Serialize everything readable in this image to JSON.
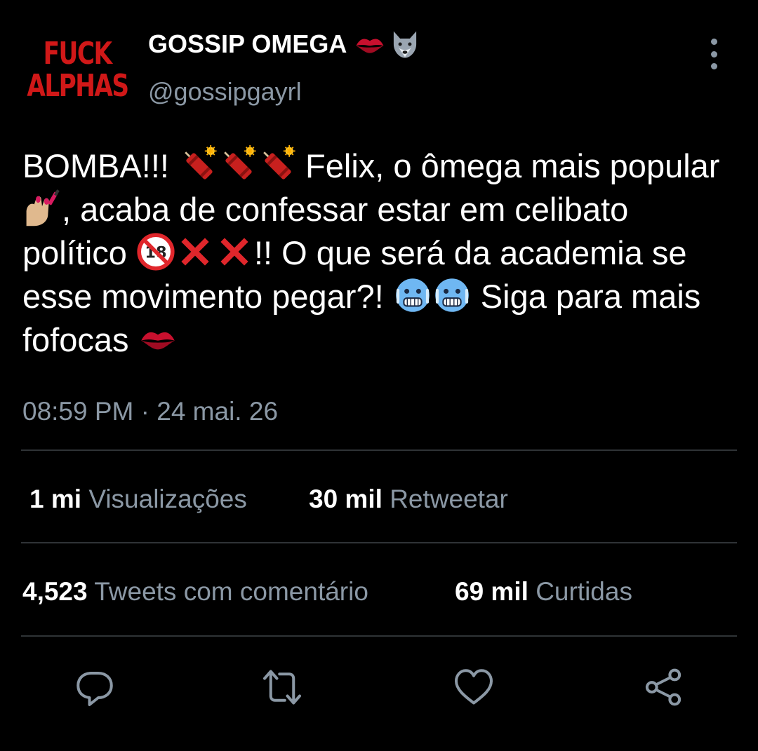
{
  "profile": {
    "avatar_line1": "FUCK",
    "avatar_line2": "ALPHAS",
    "display_name": "GOSSIP OMEGA",
    "display_name_emojis": [
      "kiss-mark-icon",
      "wolf-icon"
    ],
    "handle": "@gossipgayrl"
  },
  "tweet": {
    "segments": {
      "s1": "BOMBA!!! ",
      "s2": " Felix, o ômega mais popular ",
      "s3": ", acaba de confessar estar em celibato político ",
      "s4": "!! O que será da academia se esse movimento pegar?! ",
      "s5": " Siga para mais fofocas "
    },
    "emojis": [
      "firecracker-icon",
      "firecracker-icon",
      "firecracker-icon",
      "nail-polish-icon",
      "no-under-18-icon",
      "cross-mark-icon",
      "cross-mark-icon",
      "cold-face-icon",
      "cold-face-icon",
      "kiss-mark-icon"
    ],
    "timestamp": "08:59 PM · 24 mai. 26"
  },
  "stats": {
    "views_count": "1 mi",
    "views_label": "Visualizações",
    "retweets_count": "30 mil",
    "retweets_label": "Retweetar",
    "quotes_count": "4,523",
    "quotes_label": "Tweets com comentário",
    "likes_count": "69 mil",
    "likes_label": "Curtidas"
  },
  "actions": [
    "reply-icon",
    "retweet-icon",
    "like-icon",
    "share-icon"
  ],
  "colors": {
    "background": "#000000",
    "text_primary": "#ffffff",
    "text_secondary": "#8b98a5",
    "divider": "#2f3336",
    "avatar_red": "#d01818"
  }
}
